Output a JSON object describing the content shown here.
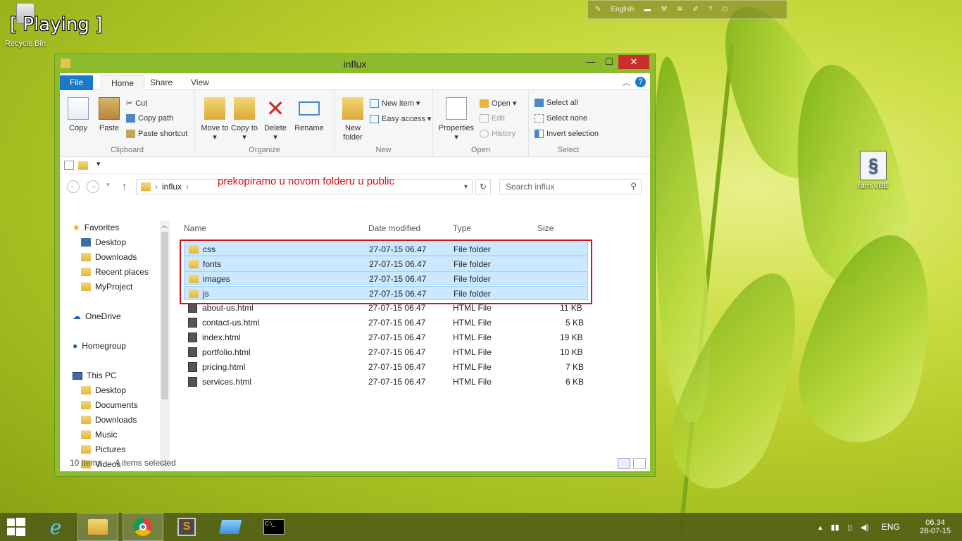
{
  "desktop": {
    "recycle_bin": "Recycle Bin",
    "overlay": "[ Playing ]",
    "right_icon": "ram.VBE",
    "language_bar": "English"
  },
  "window": {
    "title": "influx",
    "min": "—",
    "max": "☐",
    "close": "✕"
  },
  "tabs": [
    "File",
    "Home",
    "Share",
    "View"
  ],
  "ribbon": {
    "clipboard": {
      "copy": "Copy",
      "paste": "Paste",
      "cut": "Cut",
      "copy_path": "Copy path",
      "paste_shortcut": "Paste shortcut",
      "name": "Clipboard"
    },
    "organize": {
      "move_to": "Move to ▾",
      "copy_to": "Copy to ▾",
      "delete": "Delete ▾",
      "rename": "Rename",
      "name": "Organize"
    },
    "new": {
      "new_folder": "New folder",
      "new_item": "New item ▾",
      "easy_access": "Easy access ▾",
      "name": "New"
    },
    "open": {
      "properties": "Properties ▾",
      "open": "Open ▾",
      "edit": "Edit",
      "history": "History",
      "name": "Open"
    },
    "select": {
      "select_all": "Select all",
      "select_none": "Select none",
      "invert": "Invert selection",
      "name": "Select"
    }
  },
  "address": {
    "path": "influx",
    "search_placeholder": "Search influx",
    "annotation": "prekopiramo u novom folderu u public"
  },
  "nav": {
    "favorites": "Favorites",
    "fav_items": [
      "Desktop",
      "Downloads",
      "Recent places",
      "MyProject"
    ],
    "onedrive": "OneDrive",
    "homegroup": "Homegroup",
    "thispc": "This PC",
    "pc_items": [
      "Desktop",
      "Documents",
      "Downloads",
      "Music",
      "Pictures",
      "Videos"
    ]
  },
  "columns": {
    "name": "Name",
    "date": "Date modified",
    "type": "Type",
    "size": "Size"
  },
  "files": [
    {
      "name": "css",
      "date": "27-07-15 06.47",
      "type": "File folder",
      "size": ""
    },
    {
      "name": "fonts",
      "date": "27-07-15 06.47",
      "type": "File folder",
      "size": ""
    },
    {
      "name": "images",
      "date": "27-07-15 06.47",
      "type": "File folder",
      "size": ""
    },
    {
      "name": "js",
      "date": "27-07-15 06.47",
      "type": "File folder",
      "size": ""
    },
    {
      "name": "about-us.html",
      "date": "27-07-15 06.47",
      "type": "HTML File",
      "size": "11 KB"
    },
    {
      "name": "contact-us.html",
      "date": "27-07-15 06.47",
      "type": "HTML File",
      "size": "5 KB"
    },
    {
      "name": "index.html",
      "date": "27-07-15 06.47",
      "type": "HTML File",
      "size": "19 KB"
    },
    {
      "name": "portfolio.html",
      "date": "27-07-15 06.47",
      "type": "HTML File",
      "size": "10 KB"
    },
    {
      "name": "pricing.html",
      "date": "27-07-15 06.47",
      "type": "HTML File",
      "size": "7 KB"
    },
    {
      "name": "services.html",
      "date": "27-07-15 06.47",
      "type": "HTML File",
      "size": "6 KB"
    }
  ],
  "status": {
    "items": "10 items",
    "selected": "4 items selected"
  },
  "taskbar": {
    "lang": "ENG",
    "time": "06.34",
    "date": "28-07-15"
  },
  "colors": {
    "accent": "#1979ca",
    "window_frame": "#8dbb2e",
    "selection": "#cce8ff",
    "annotation": "#d0121b"
  }
}
